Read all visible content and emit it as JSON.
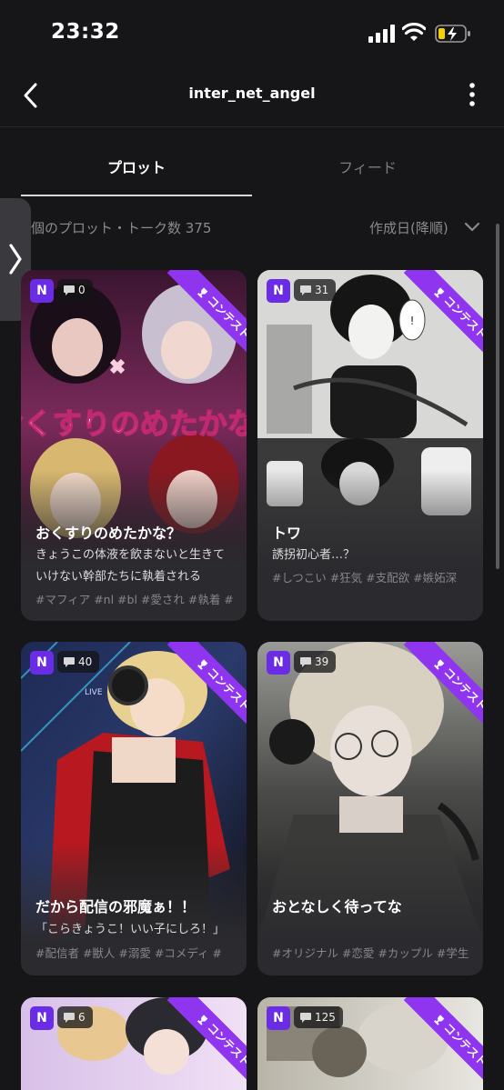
{
  "status_bar": {
    "time": "23:32"
  },
  "header": {
    "title": "inter_net_angel"
  },
  "tabs": [
    {
      "label": "プロット",
      "active": true
    },
    {
      "label": "フィード",
      "active": false
    }
  ],
  "summary": {
    "count_text": "個のプロット・トーク数 375",
    "sort_label": "作成日(降順)"
  },
  "badges": {
    "n_label": "N",
    "contest_label": "コンテスト"
  },
  "colors": {
    "accent": "#8f35f0",
    "badge": "#6b2ce6",
    "card": "#2b2b2f",
    "background": "#161618"
  },
  "cards": [
    {
      "comments": "0",
      "title": "おくすりのめたかな？",
      "description": "きょうこの体液を飲まないと生きていけない幹部たちに執着される",
      "tags": "#マフィア #nl #bl #愛され #執着 #",
      "cover_text": "おくすりのめたかな?"
    },
    {
      "comments": "31",
      "title": "トワ",
      "description": "誘拐初心者…？",
      "tags": "#しつこい #狂気 #支配欲 #嫉妬深",
      "speech_bubble": "!"
    },
    {
      "comments": "40",
      "title": "だから配信の邪魔ぁ！！",
      "description": "「こらきょうこ！いい子にしろ！」",
      "tags": "#配信者 #獣人 #溺愛 #コメディ #",
      "sign_text": "LIVE"
    },
    {
      "comments": "39",
      "title": "おとなしく待ってな",
      "description": "",
      "tags": "#オリジナル #恋愛 #カップル #学生"
    },
    {
      "comments": "6"
    },
    {
      "comments": "125"
    }
  ]
}
